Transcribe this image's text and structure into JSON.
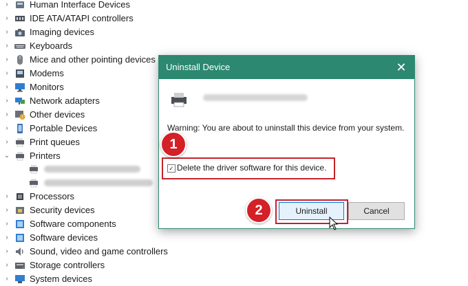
{
  "device_tree": {
    "categories": [
      {
        "label": "Human Interface Devices",
        "icon": "hid-icon",
        "expanded": false
      },
      {
        "label": "IDE ATA/ATAPI controllers",
        "icon": "ide-controller-icon",
        "expanded": false
      },
      {
        "label": "Imaging devices",
        "icon": "camera-icon",
        "expanded": false
      },
      {
        "label": "Keyboards",
        "icon": "keyboard-icon",
        "expanded": false
      },
      {
        "label": "Mice and other pointing devices",
        "icon": "mouse-icon",
        "expanded": false
      },
      {
        "label": "Modems",
        "icon": "modem-icon",
        "expanded": false
      },
      {
        "label": "Monitors",
        "icon": "monitor-icon",
        "expanded": false
      },
      {
        "label": "Network adapters",
        "icon": "network-adapter-icon",
        "expanded": false
      },
      {
        "label": "Other devices",
        "icon": "unknown-device-icon",
        "expanded": false
      },
      {
        "label": "Portable Devices",
        "icon": "portable-device-icon",
        "expanded": false
      },
      {
        "label": "Print queues",
        "icon": "print-queue-icon",
        "expanded": false
      },
      {
        "label": "Printers",
        "icon": "printer-icon",
        "expanded": true
      },
      {
        "label": "Processors",
        "icon": "processor-icon",
        "expanded": false
      },
      {
        "label": "Security devices",
        "icon": "security-device-icon",
        "expanded": false
      },
      {
        "label": "Software components",
        "icon": "software-component-icon",
        "expanded": false
      },
      {
        "label": "Software devices",
        "icon": "software-device-icon",
        "expanded": false
      },
      {
        "label": "Sound, video and game controllers",
        "icon": "sound-icon",
        "expanded": false
      },
      {
        "label": "Storage controllers",
        "icon": "storage-controller-icon",
        "expanded": false
      },
      {
        "label": "System devices",
        "icon": "system-device-icon",
        "expanded": false
      }
    ],
    "printer_children": [
      {
        "icon": "printer-icon"
      },
      {
        "icon": "printer-icon"
      }
    ]
  },
  "dialog": {
    "title": "Uninstall Device",
    "close_glyph": "✕",
    "warning": "Warning: You are about to uninstall this device from your system.",
    "checkbox_label": "Delete the driver software for this device.",
    "checkbox_checked": true,
    "checkbox_glyph": "✓",
    "uninstall_label": "Uninstall",
    "cancel_label": "Cancel"
  },
  "callouts": {
    "step1": "1",
    "step2": "2"
  },
  "colors": {
    "titlebar": "#2c8870",
    "highlight": "#c4222a",
    "badge": "#d42027",
    "primary_button_border": "#0078d7"
  }
}
